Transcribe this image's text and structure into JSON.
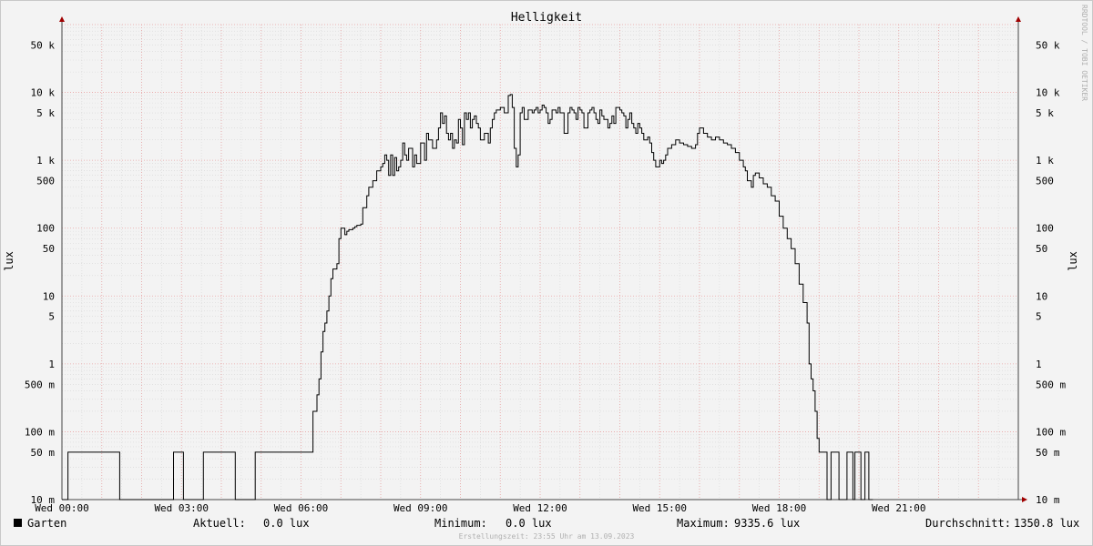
{
  "chart_data": {
    "type": "line",
    "title": "Helligkeit",
    "ylabel": "lux",
    "y_scale": "log",
    "ylim": [
      0.01,
      100000
    ],
    "y_ticks": [
      {
        "value": 50000,
        "label": "50 k"
      },
      {
        "value": 10000,
        "label": "10 k"
      },
      {
        "value": 5000,
        "label": "5 k"
      },
      {
        "value": 1000,
        "label": "1 k"
      },
      {
        "value": 500,
        "label": "500"
      },
      {
        "value": 100,
        "label": "100"
      },
      {
        "value": 50,
        "label": "50"
      },
      {
        "value": 10,
        "label": "10"
      },
      {
        "value": 5,
        "label": "5"
      },
      {
        "value": 1,
        "label": "1"
      },
      {
        "value": 0.5,
        "label": "500 m"
      },
      {
        "value": 0.1,
        "label": "100 m"
      },
      {
        "value": 0.05,
        "label": "50 m"
      },
      {
        "value": 0.01,
        "label": "10 m"
      }
    ],
    "x_ticks": [
      "Wed 00:00",
      "Wed 03:00",
      "Wed 06:00",
      "Wed 09:00",
      "Wed 12:00",
      "Wed 15:00",
      "Wed 18:00",
      "Wed 21:00"
    ],
    "xlim_hours": [
      0,
      24
    ],
    "grid": true,
    "series": [
      {
        "name": "Garten",
        "color": "#000000",
        "x_hours": [
          0.0,
          0.1,
          0.15,
          1.4,
          1.45,
          2.75,
          2.8,
          3.0,
          3.05,
          3.5,
          3.55,
          4.3,
          4.35,
          4.8,
          4.85,
          6.25,
          6.3,
          6.4,
          6.45,
          6.5,
          6.55,
          6.6,
          6.65,
          6.7,
          6.75,
          6.8,
          6.9,
          6.95,
          7.0,
          7.1,
          7.15,
          7.2,
          7.3,
          7.35,
          7.4,
          7.5,
          7.55,
          7.65,
          7.7,
          7.8,
          7.9,
          8.0,
          8.05,
          8.1,
          8.15,
          8.2,
          8.25,
          8.3,
          8.35,
          8.4,
          8.45,
          8.5,
          8.55,
          8.6,
          8.65,
          8.7,
          8.8,
          8.85,
          8.9,
          9.0,
          9.1,
          9.15,
          9.2,
          9.3,
          9.4,
          9.45,
          9.5,
          9.55,
          9.6,
          9.65,
          9.7,
          9.75,
          9.8,
          9.85,
          9.9,
          9.95,
          10.0,
          10.05,
          10.1,
          10.15,
          10.2,
          10.25,
          10.3,
          10.35,
          10.4,
          10.45,
          10.5,
          10.6,
          10.7,
          10.75,
          10.8,
          10.85,
          10.9,
          11.0,
          11.1,
          11.2,
          11.25,
          11.3,
          11.35,
          11.4,
          11.45,
          11.5,
          11.55,
          11.6,
          11.7,
          11.8,
          11.85,
          11.9,
          11.95,
          12.0,
          12.05,
          12.1,
          12.15,
          12.2,
          12.25,
          12.3,
          12.4,
          12.45,
          12.5,
          12.6,
          12.7,
          12.75,
          12.8,
          12.85,
          12.9,
          12.95,
          13.0,
          13.05,
          13.1,
          13.2,
          13.25,
          13.3,
          13.35,
          13.4,
          13.45,
          13.5,
          13.55,
          13.6,
          13.7,
          13.75,
          13.8,
          13.85,
          13.9,
          14.0,
          14.05,
          14.1,
          14.15,
          14.2,
          14.25,
          14.3,
          14.35,
          14.4,
          14.45,
          14.5,
          14.55,
          14.6,
          14.7,
          14.75,
          14.8,
          14.85,
          14.9,
          15.0,
          15.05,
          15.1,
          15.15,
          15.2,
          15.3,
          15.4,
          15.5,
          15.6,
          15.7,
          15.8,
          15.9,
          15.95,
          16.0,
          16.1,
          16.2,
          16.3,
          16.4,
          16.5,
          16.6,
          16.7,
          16.8,
          16.9,
          17.0,
          17.1,
          17.15,
          17.2,
          17.3,
          17.35,
          17.4,
          17.5,
          17.6,
          17.7,
          17.8,
          17.9,
          18.0,
          18.1,
          18.2,
          18.3,
          18.4,
          18.5,
          18.6,
          18.7,
          18.75,
          18.8,
          18.85,
          18.9,
          18.95,
          19.0,
          19.1,
          19.2,
          19.25,
          19.3,
          19.4,
          19.5,
          19.6,
          19.7,
          19.8,
          19.85,
          19.9,
          20.0,
          20.05,
          20.1,
          20.15,
          20.2,
          20.25,
          20.3,
          20.35,
          20.4,
          20.45,
          20.5,
          20.55,
          20.6,
          20.65,
          20.7,
          20.75,
          20.8,
          20.85,
          20.9,
          21.0,
          21.1,
          21.2,
          21.25,
          21.3,
          21.45,
          21.5,
          21.55,
          22.0,
          22.05,
          22.2,
          22.25,
          22.5,
          22.55,
          22.65,
          22.7,
          22.9,
          22.95,
          23.0,
          23.05,
          23.15,
          23.2,
          23.7,
          23.75,
          24.0
        ],
        "y_lux": [
          0.01,
          0.01,
          0.05,
          0.05,
          0.01,
          0.01,
          0.05,
          0.05,
          0.01,
          0.01,
          0.05,
          0.05,
          0.01,
          0.01,
          0.05,
          0.05,
          0.2,
          0.35,
          0.6,
          1.5,
          3,
          4,
          6,
          10,
          18,
          25,
          30,
          70,
          100,
          80,
          90,
          95,
          100,
          105,
          110,
          115,
          200,
          300,
          400,
          500,
          700,
          800,
          900,
          1200,
          1000,
          600,
          1200,
          600,
          1100,
          700,
          800,
          1000,
          1800,
          1200,
          1000,
          1500,
          800,
          1200,
          900,
          1800,
          1000,
          2500,
          2000,
          1500,
          2000,
          3000,
          5000,
          3500,
          4500,
          2500,
          2000,
          2500,
          1500,
          2000,
          1800,
          4000,
          3000,
          1700,
          5000,
          4000,
          5000,
          3000,
          4000,
          4500,
          3500,
          3000,
          2000,
          2500,
          1800,
          3000,
          4000,
          5000,
          5500,
          6000,
          5000,
          9000,
          9300,
          6000,
          1500,
          800,
          1200,
          5000,
          6000,
          4000,
          5500,
          5000,
          5500,
          6000,
          5000,
          5500,
          6500,
          6000,
          5000,
          3500,
          4000,
          5500,
          5000,
          6000,
          5000,
          2500,
          5000,
          6000,
          5500,
          5000,
          4000,
          6000,
          5500,
          5000,
          3000,
          5000,
          5500,
          6000,
          5000,
          4000,
          3500,
          5500,
          4500,
          4000,
          3000,
          3500,
          4500,
          3500,
          6000,
          5500,
          5000,
          4500,
          3000,
          4000,
          5000,
          3500,
          3000,
          2500,
          3500,
          3000,
          2500,
          2000,
          2200,
          1800,
          1300,
          1000,
          800,
          1000,
          900,
          1000,
          1200,
          1500,
          1700,
          2000,
          1800,
          1700,
          1600,
          1500,
          1700,
          2500,
          3000,
          2500,
          2200,
          2000,
          2200,
          2000,
          1800,
          1700,
          1500,
          1300,
          1000,
          800,
          700,
          500,
          400,
          600,
          650,
          550,
          450,
          400,
          300,
          250,
          150,
          100,
          70,
          50,
          30,
          15,
          8,
          4,
          1,
          0.6,
          0.4,
          0.2,
          0.08,
          0.05,
          0.05,
          0.01,
          0.01,
          0.05,
          0.05,
          0.01,
          0.01,
          0.05,
          0.05,
          0.01,
          0.05,
          0.05,
          0.01,
          0.01,
          0.05,
          0.05,
          0.01,
          0.01
        ]
      }
    ]
  },
  "legend": {
    "series_name": "Garten",
    "aktuell_label": "Aktuell:",
    "aktuell_value": "0.0 lux",
    "minimum_label": "Minimum:",
    "minimum_value": "0.0 lux",
    "maximum_label": "Maximum:",
    "maximum_value": "9335.6 lux",
    "average_label": "Durchschnitt:",
    "average_value": "1350.8 lux"
  },
  "footer": "Erstellungszeit: 23:55 Uhr am 13.09.2023",
  "watermark": "RRDTOOL / TOBI OETIKER"
}
